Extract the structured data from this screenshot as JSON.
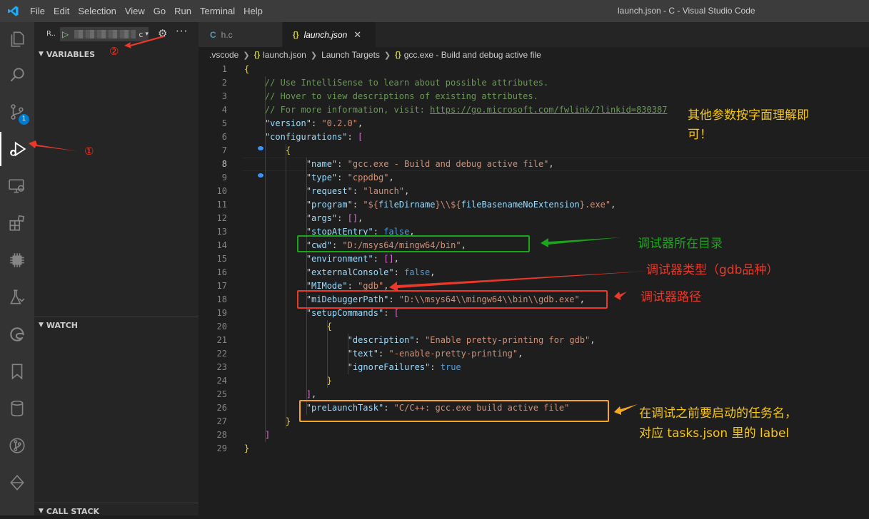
{
  "window": {
    "title": "launch.json - C - Visual Studio Code"
  },
  "menu": [
    "File",
    "Edit",
    "Selection",
    "View",
    "Go",
    "Run",
    "Terminal",
    "Help"
  ],
  "activity": {
    "scm_badge": "1"
  },
  "sidebar": {
    "run_label": "R..",
    "config_tail": "c",
    "sections": {
      "variables": "VARIABLES",
      "watch": "WATCH",
      "call_stack": "CALL STACK"
    }
  },
  "tabs": [
    {
      "label": "h.c",
      "icon": "C"
    },
    {
      "label": "launch.json",
      "icon": "{}"
    }
  ],
  "breadcrumb": [
    ".vscode",
    "launch.json",
    "Launch Targets",
    "gcc.exe - Build and debug active file"
  ],
  "editor": {
    "current_line": 8,
    "lines": [
      "{",
      "    // Use IntelliSense to learn about possible attributes.",
      "    // Hover to view descriptions of existing attributes.",
      "    // For more information, visit: https://go.microsoft.com/fwlink/?linkid=830387",
      "    \"version\": \"0.2.0\",",
      "    \"configurations\": [",
      "        {",
      "            \"name\": \"gcc.exe - Build and debug active file\",",
      "            \"type\": \"cppdbg\",",
      "            \"request\": \"launch\",",
      "            \"program\": \"${fileDirname}\\\\${fileBasenameNoExtension}.exe\",",
      "            \"args\": [],",
      "            \"stopAtEntry\": false,",
      "            \"cwd\": \"D:/msys64/mingw64/bin\",",
      "            \"environment\": [],",
      "            \"externalConsole\": false,",
      "            \"MIMode\": \"gdb\",",
      "            \"miDebuggerPath\": \"D:\\\\msys64\\\\mingw64\\\\bin\\\\gdb.exe\",",
      "            \"setupCommands\": [",
      "                {",
      "                    \"description\": \"Enable pretty-printing for gdb\",",
      "                    \"text\": \"-enable-pretty-printing\",",
      "                    \"ignoreFailures\": true",
      "                }",
      "            ],",
      "            \"preLaunchTask\": \"C/C++: gcc.exe build active file\"",
      "        }",
      "    ]",
      "}"
    ]
  },
  "annotations": {
    "marker1": "①",
    "marker2": "②",
    "note_other_line1": "其他参数按字面理解即",
    "note_other_line2": "可！",
    "note_cwd": "调试器所在目录",
    "note_type": "调试器类型（gdb品种）",
    "note_path": "调试器路径",
    "note_task_line1": "在调试之前要启动的任务名，",
    "note_task_line2": "对应 tasks.json 里的 label",
    "colors": {
      "red": "#e8392b",
      "green": "#1aa51a",
      "orange": "#f5a623",
      "yellow_text": "#f5c518"
    }
  }
}
